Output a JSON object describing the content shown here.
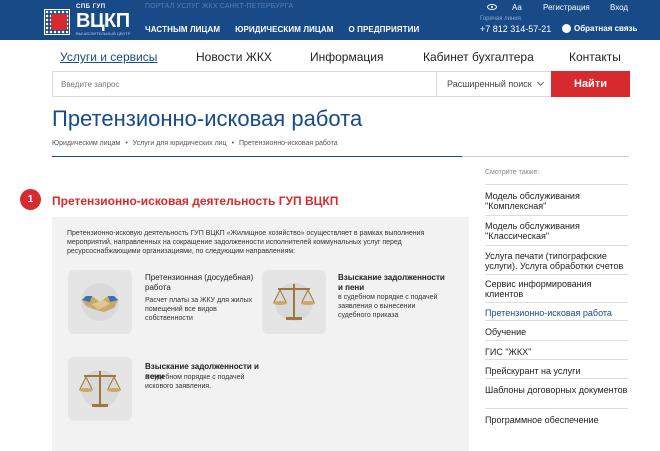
{
  "header": {
    "logo_small": "СПБ ГУП",
    "logo_big": "ВЦКП",
    "logo_tag": "ВЫЧИСЛИТЕЛЬНЫЙ ЦЕНТР",
    "portal_text": "ПОРТАЛ УСЛУГ ЖКХ САНКТ-ПЕТЕРБУРГА",
    "top_nav": [
      "Частным лицам",
      "Юридическим лицам",
      "О предприятии"
    ],
    "hotline_label": "Горячая линия",
    "phone": "+7 812 314-57-21",
    "font_toggle": "Aa",
    "register": "Регистрация",
    "login": "Вход",
    "feedback": "Обратная связь"
  },
  "main_nav": [
    "Услуги и сервисы",
    "Новости ЖКХ",
    "Информация",
    "Кабинет бухгалтера",
    "Контакты"
  ],
  "search": {
    "placeholder": "Введите запрос",
    "advanced": "Расширенный поиск",
    "button": "Найти"
  },
  "page": {
    "title": "Претензионно-исковая работа",
    "breadcrumb": [
      "Юридическим лицам",
      "•",
      "Услуги для юридических лиц",
      "•",
      "Претензионно-исковая работа"
    ]
  },
  "section": {
    "number": "1",
    "title": "Претензионно-исковая деятельность ГУП ВЦКП",
    "intro": "Претензионно-исковую деятельность ГУП ВЦКП «Жилищное хозяйство» осуществляет в рамках выполнения мероприятий, направленных на сокращение задолженности исполнителей коммунальных услуг перед ресурсоснабжающими организациями, по следующим направлениям:",
    "cards": [
      {
        "title": "Претензионная (досудебная) работа",
        "text": "Расчет платы за ЖКУ для жилых помещений все видов собственности",
        "icon": "handshake-icon"
      },
      {
        "title": "Взыскание задолженности и пени",
        "text": "в судебном порядке с подачей заявления о вынесении судебного приказа",
        "icon": "scales-icon"
      },
      {
        "title": "Взыскание задолженности и пени",
        "text": "в судебном порядке с подачей искового заявления.",
        "icon": "scales-icon"
      }
    ]
  },
  "sidebar": {
    "heading": "Смотрите также:",
    "items": [
      "Модель обслуживания \"Комплексная\"",
      "Модель обслуживания \"Классическая\"",
      "Услуга печати (типографские услуги). Услуга обработки счетов",
      "Сервис информирования клиентов",
      "Претензионно-исковая работа",
      "Обучение",
      "ГИС \"ЖКХ\"",
      "Прейскурант на услуги",
      "Шаблоны договорных документов",
      "Программное обеспечение"
    ]
  },
  "colors": {
    "brand_blue": "#174a87",
    "accent_red": "#d72a2f"
  }
}
